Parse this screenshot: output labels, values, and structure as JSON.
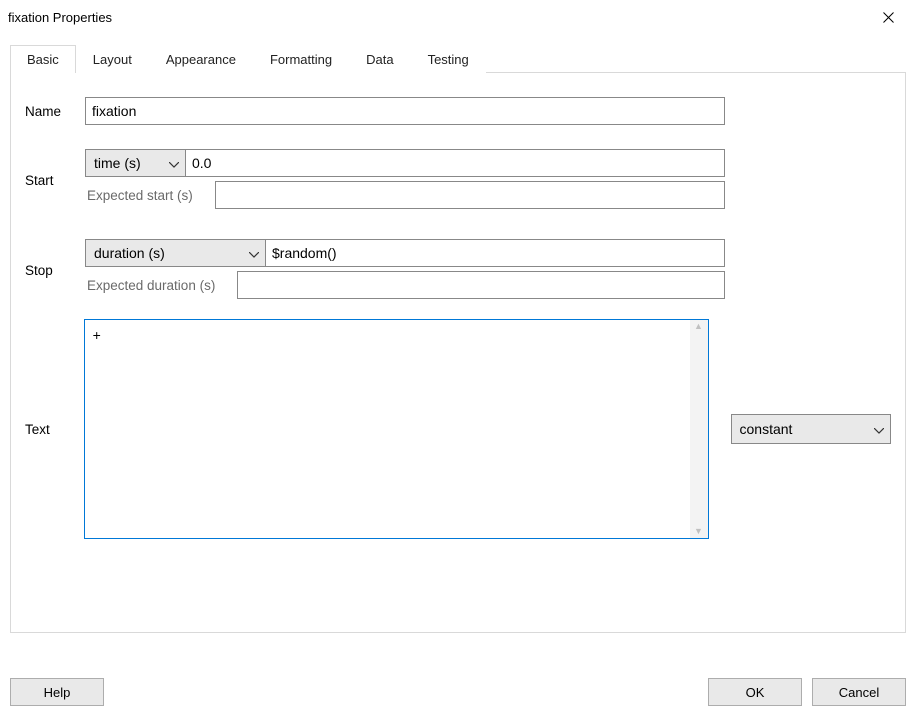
{
  "window": {
    "title": "fixation Properties"
  },
  "tabs": [
    {
      "label": "Basic",
      "active": true
    },
    {
      "label": "Layout",
      "active": false
    },
    {
      "label": "Appearance",
      "active": false
    },
    {
      "label": "Formatting",
      "active": false
    },
    {
      "label": "Data",
      "active": false
    },
    {
      "label": "Testing",
      "active": false
    }
  ],
  "fields": {
    "name_label": "Name",
    "name_value": "fixation",
    "start_label": "Start",
    "start_type": "time (s)",
    "start_value": "0.0",
    "start_expected_label": "Expected start (s)",
    "start_expected_value": "",
    "stop_label": "Stop",
    "stop_type": "duration (s)",
    "stop_value": "$random()",
    "stop_expected_label": "Expected duration (s)",
    "stop_expected_value": "",
    "text_label": "Text",
    "text_value": "+",
    "text_type": "constant"
  },
  "buttons": {
    "help": "Help",
    "ok": "OK",
    "cancel": "Cancel"
  }
}
